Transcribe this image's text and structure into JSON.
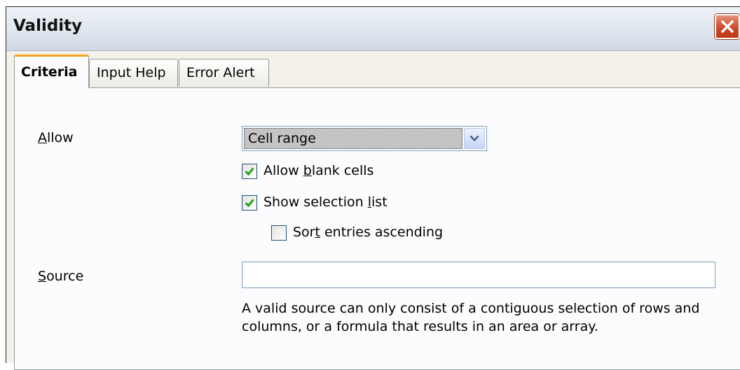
{
  "dialog": {
    "title": "Validity",
    "close_icon": "close-icon"
  },
  "tabs": [
    {
      "label": "Criteria",
      "active": true
    },
    {
      "label": "Input Help",
      "active": false
    },
    {
      "label": "Error Alert",
      "active": false
    }
  ],
  "criteria": {
    "allow_label": "Allow",
    "allow_value": "Cell range",
    "allow_blank": {
      "label": "Allow blank cells",
      "checked": true
    },
    "show_list": {
      "label": "Show selection list",
      "checked": true
    },
    "sort_asc": {
      "label": "Sort entries ascending",
      "checked": false
    },
    "source_label": "Source",
    "source_value": "",
    "hint": "A valid source can only consist of a contiguous selection of rows and columns, or a formula that results in an area or array."
  },
  "colors": {
    "accent_tab": "#f5a623",
    "close_button": "#cf4a2a",
    "checkmark": "#21a121"
  }
}
